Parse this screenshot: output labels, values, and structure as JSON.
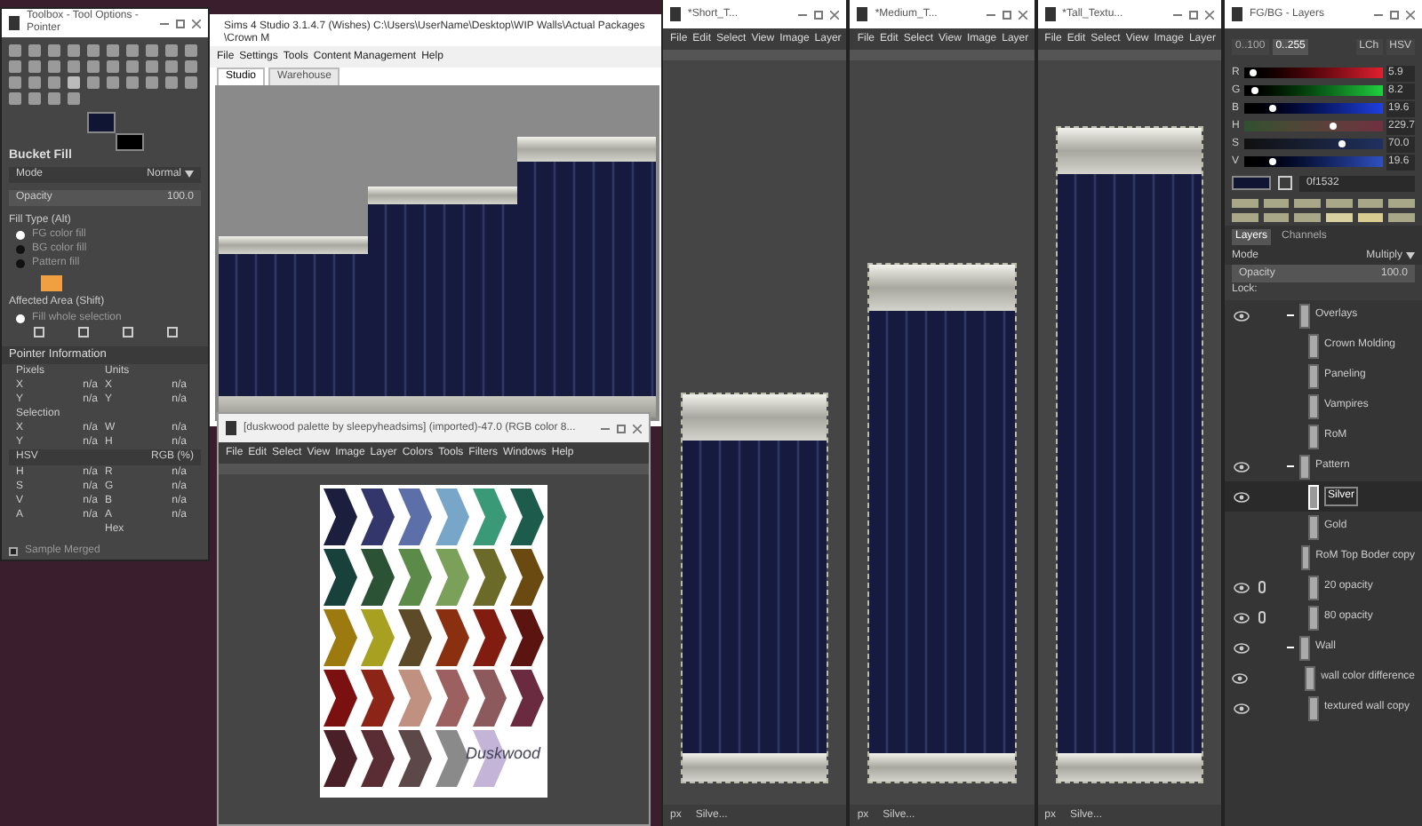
{
  "toolbox": {
    "title": "Toolbox - Tool Options - Pointer",
    "tool_name": "Bucket Fill",
    "mode_label": "Mode",
    "mode_value": "Normal",
    "opacity_label": "Opacity",
    "opacity_value": "100.0",
    "fill_type_label": "Fill Type  (Alt)",
    "fill_options": [
      {
        "label": "FG color fill",
        "selected": true
      },
      {
        "label": "BG color fill",
        "selected": false
      },
      {
        "label": "Pattern fill",
        "selected": false
      }
    ],
    "affected_label": "Affected Area  (Shift)",
    "affected_option": {
      "label": "Fill whole selection",
      "selected": true
    },
    "pointer_title": "Pointer Information",
    "pointer_rows": [
      [
        "Pixels",
        "",
        "Units",
        ""
      ],
      [
        "X",
        "n/a",
        "X",
        "n/a"
      ],
      [
        "Y",
        "n/a",
        "Y",
        "n/a"
      ],
      [
        "Selection",
        "",
        "",
        ""
      ],
      [
        "X",
        "n/a",
        "W",
        "n/a"
      ],
      [
        "Y",
        "n/a",
        "H",
        "n/a"
      ]
    ],
    "color_mode_left": "HSV",
    "color_mode_right": "RGB (%)",
    "color_rows": [
      [
        "H",
        "n/a",
        "R",
        "n/a"
      ],
      [
        "S",
        "n/a",
        "G",
        "n/a"
      ],
      [
        "V",
        "n/a",
        "B",
        "n/a"
      ],
      [
        "A",
        "n/a",
        "A",
        "n/a"
      ],
      [
        "",
        "",
        "Hex",
        ""
      ]
    ],
    "sample_merged": {
      "label": "Sample Merged",
      "checked": false
    }
  },
  "sims": {
    "title": "Sims 4 Studio 3.1.4.7 (Wishes)  C:\\Users\\UserName\\Desktop\\WIP Walls\\Actual Packages\\Crown M",
    "menu": [
      "File",
      "Settings",
      "Tools",
      "Content Management",
      "Help"
    ],
    "tabs": [
      {
        "label": "Studio",
        "selected": true
      },
      {
        "label": "Warehouse",
        "selected": false
      }
    ]
  },
  "palette_window": {
    "title": "[duskwood palette by sleepyheadsims] (imported)-47.0 (RGB color 8...",
    "menu": [
      "File",
      "Edit",
      "Select",
      "View",
      "Image",
      "Layer",
      "Colors",
      "Tools",
      "Filters",
      "Windows",
      "Help"
    ],
    "swatches": [
      {
        "color": "#1b1e3c"
      },
      {
        "color": "#33366a"
      },
      {
        "color": "#5d6fa8"
      },
      {
        "color": "#78a6c8"
      },
      {
        "color": "#3a9a78"
      },
      {
        "color": "#1d5c4c"
      },
      {
        "color": "#17413a"
      },
      {
        "color": "#2c5236"
      },
      {
        "color": "#5c8a48"
      },
      {
        "color": "#7aa05a"
      },
      {
        "color": "#6c6a28"
      },
      {
        "color": "#6a4a10"
      },
      {
        "color": "#9c7a10"
      },
      {
        "color": "#a8a020"
      },
      {
        "color": "#5c4a28"
      },
      {
        "color": "#8a3010"
      },
      {
        "color": "#801c10"
      },
      {
        "color": "#5c1410"
      },
      {
        "color": "#7a1010"
      },
      {
        "color": "#8c2418"
      },
      {
        "color": "#c09080"
      },
      {
        "color": "#9c6060"
      },
      {
        "color": "#8c5a5c"
      },
      {
        "color": "#6a2a40"
      },
      {
        "color": "#4a2028"
      },
      {
        "color": "#5a2c34"
      },
      {
        "color": "#5c4848"
      },
      {
        "color": "#8a8a8a"
      },
      {
        "color": "#c4b4d8"
      }
    ],
    "caption": "Duskwood"
  },
  "image_windows": [
    {
      "title": "*Short_T...",
      "menu": [
        "File",
        "Edit",
        "Select",
        "View",
        "Image",
        "Layer"
      ],
      "kind": "short",
      "unit": "px",
      "layer": "Silve..."
    },
    {
      "title": "*Medium_T...",
      "menu": [
        "File",
        "Edit",
        "Select",
        "View",
        "Image",
        "Layer"
      ],
      "kind": "medium",
      "unit": "px",
      "layer": "Silve..."
    },
    {
      "title": "*Tall_Textu...",
      "menu": [
        "File",
        "Edit",
        "Select",
        "View",
        "Image",
        "Layer"
      ],
      "kind": "tall",
      "unit": "px",
      "layer": "Silve..."
    }
  ],
  "fgbg": {
    "title": "FG/BG - Layers",
    "range_buttons": [
      {
        "label": "0..100",
        "selected": false
      },
      {
        "label": "0..255",
        "selected": true
      }
    ],
    "model_buttons": [
      "LCh",
      "HSV"
    ],
    "channels": [
      {
        "name": "R",
        "level": 0.06,
        "reading": "5.9"
      },
      {
        "name": "G",
        "level": 0.08,
        "reading": "8.2"
      },
      {
        "name": "B",
        "level": 0.2,
        "reading": "19.6"
      },
      {
        "name": "H",
        "level": 0.64,
        "reading": "229.7"
      },
      {
        "name": "S",
        "level": 0.7,
        "reading": "70.0"
      },
      {
        "name": "V",
        "level": 0.2,
        "reading": "19.6"
      }
    ],
    "hex": "0f1532",
    "history": [
      {
        "color": "#a8a888"
      },
      {
        "color": "#a8a888"
      },
      {
        "color": "#a8a888"
      },
      {
        "color": "#a8a888"
      },
      {
        "color": "#a8a888"
      },
      {
        "color": "#a8a888"
      },
      {
        "color": "#a8a888"
      },
      {
        "color": "#a8a888"
      },
      {
        "color": "#a8a888"
      },
      {
        "color": "#d8d0a0"
      },
      {
        "color": "#d8cc90"
      },
      {
        "color": "#a8a888"
      }
    ]
  },
  "layers": {
    "tabs": [
      {
        "label": "Layers",
        "selected": true
      },
      {
        "label": "Channels",
        "selected": false
      }
    ],
    "mode_label": "Mode",
    "mode_value": "Multiply",
    "opacity_label": "Opacity",
    "opacity_value": "100.0",
    "lock_label": "Lock:",
    "items": [
      {
        "name": "Overlays",
        "visible": true,
        "selected": false,
        "linked": false,
        "children": [
          {
            "name": "Crown Molding",
            "visible": false,
            "selected": false,
            "linked": false
          },
          {
            "name": "Paneling",
            "visible": false,
            "selected": false,
            "linked": false
          },
          {
            "name": "Vampires",
            "visible": false,
            "selected": false,
            "linked": false
          },
          {
            "name": "RoM",
            "visible": false,
            "selected": false,
            "linked": false
          }
        ]
      },
      {
        "name": "Pattern",
        "visible": true,
        "selected": false,
        "linked": false,
        "children": [
          {
            "name": "Silver",
            "visible": true,
            "selected": true,
            "linked": false
          },
          {
            "name": "Gold",
            "visible": false,
            "selected": false,
            "linked": false
          },
          {
            "name": "RoM Top Boder copy",
            "visible": false,
            "selected": false,
            "linked": false
          },
          {
            "name": "20 opacity",
            "visible": true,
            "selected": false,
            "linked": true
          },
          {
            "name": "80 opacity",
            "visible": true,
            "selected": false,
            "linked": true
          }
        ]
      },
      {
        "name": "Wall",
        "visible": true,
        "selected": false,
        "linked": false,
        "children": [
          {
            "name": "wall color difference",
            "visible": true,
            "selected": false,
            "linked": false
          },
          {
            "name": "textured wall copy",
            "visible": true,
            "selected": false,
            "linked": false
          }
        ]
      }
    ]
  }
}
